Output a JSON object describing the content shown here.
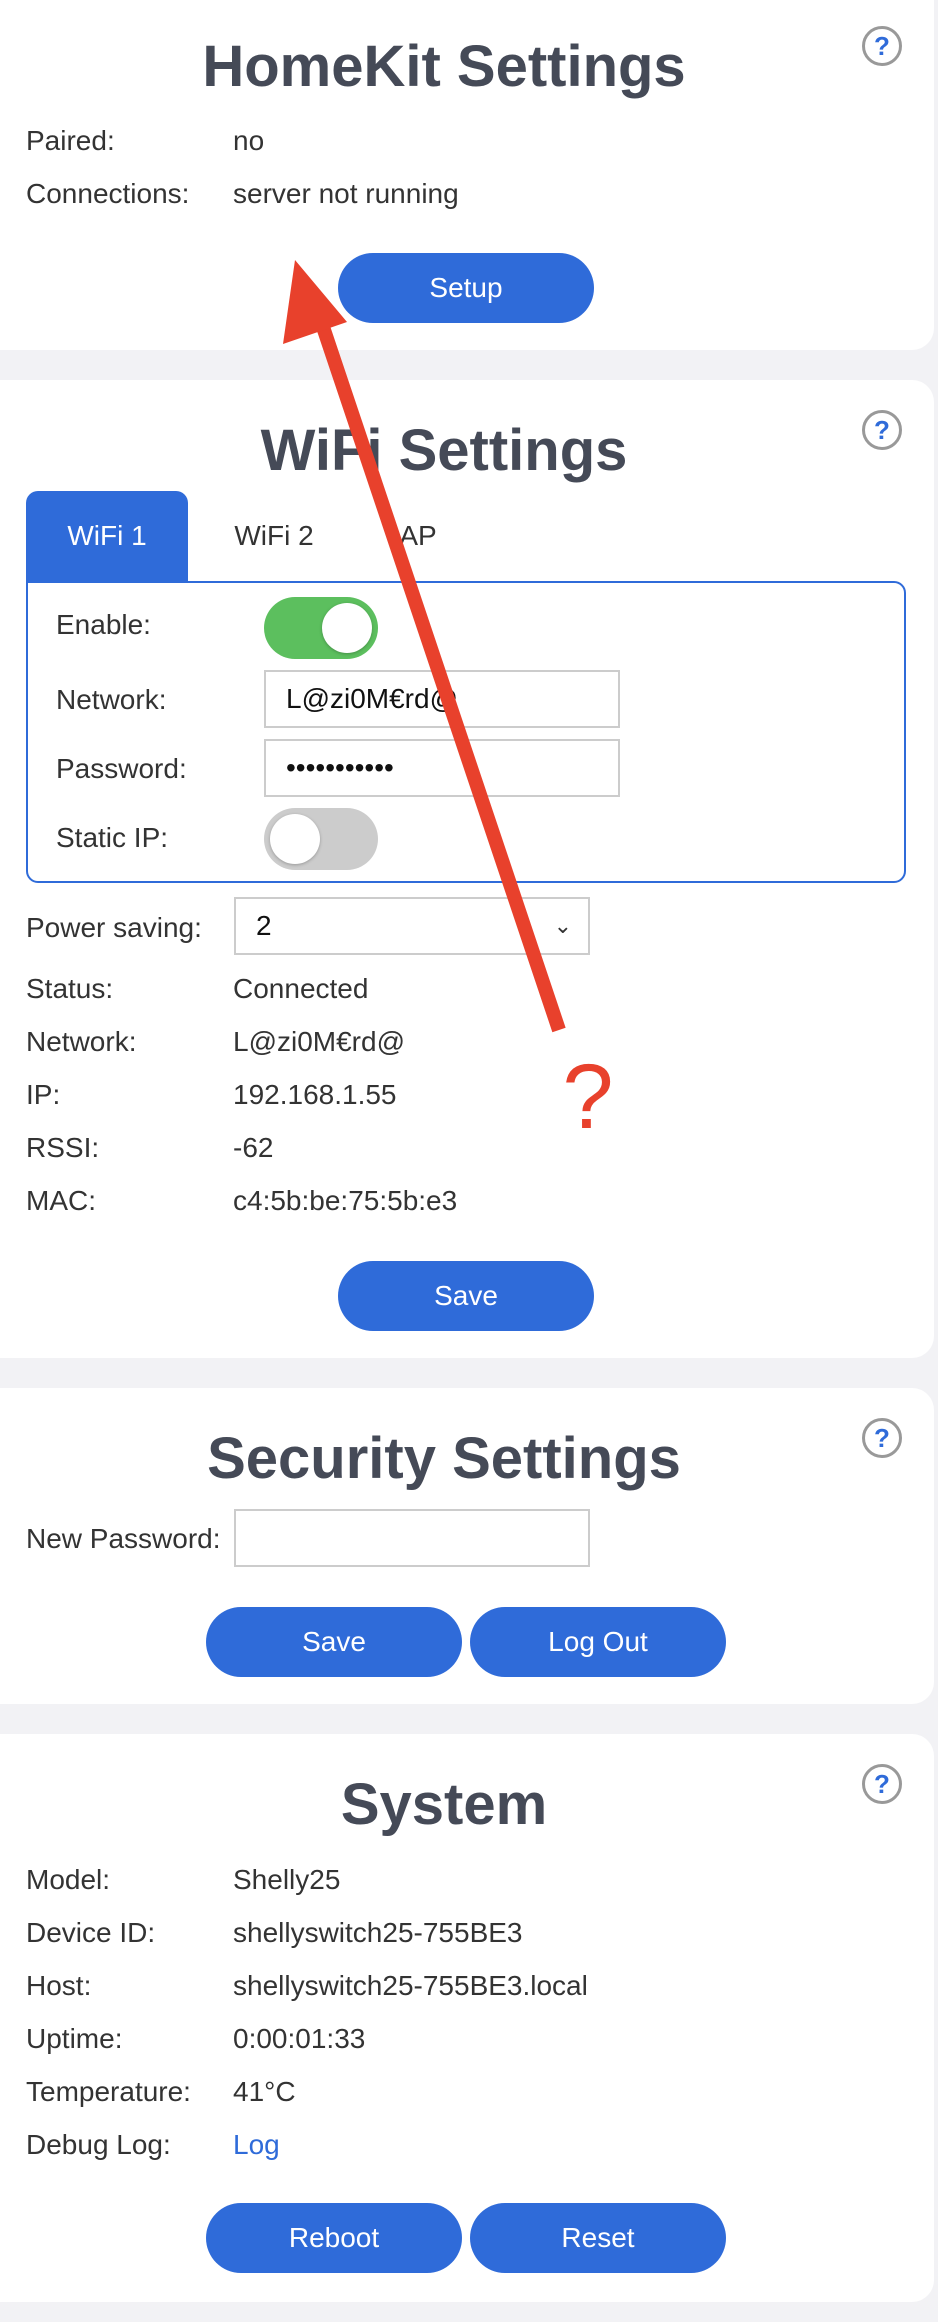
{
  "homekit": {
    "title": "HomeKit Settings",
    "help_label": "?",
    "paired_label": "Paired:",
    "paired_value": "no",
    "connections_label": "Connections:",
    "connections_value": "server not running",
    "setup_button": "Setup"
  },
  "wifi": {
    "title": "WiFi Settings",
    "help_label": "?",
    "tabs": [
      {
        "label": "WiFi 1",
        "active": true
      },
      {
        "label": "WiFi 2",
        "active": false
      },
      {
        "label": "AP",
        "active": false
      }
    ],
    "enable_label": "Enable:",
    "enable_on": true,
    "network_label": "Network:",
    "network_value": "L@zi0M€rd@",
    "password_label": "Password:",
    "password_value": "•••••••••••",
    "static_ip_label": "Static IP:",
    "static_ip_on": false,
    "power_saving_label": "Power saving:",
    "power_saving_value": "2",
    "status": [
      {
        "label": "Status:",
        "value": "Connected"
      },
      {
        "label": "Network:",
        "value": "L@zi0M€rd@"
      },
      {
        "label": "IP:",
        "value": "192.168.1.55"
      },
      {
        "label": "RSSI:",
        "value": "-62"
      },
      {
        "label": "MAC:",
        "value": "c4:5b:be:75:5b:e3"
      }
    ],
    "save_button": "Save"
  },
  "security": {
    "title": "Security Settings",
    "help_label": "?",
    "new_password_label": "New Password:",
    "new_password_value": "",
    "save_button": "Save",
    "logout_button": "Log Out"
  },
  "system": {
    "title": "System",
    "help_label": "?",
    "rows": [
      {
        "label": "Model:",
        "value": "Shelly25"
      },
      {
        "label": "Device ID:",
        "value": "shellyswitch25-755BE3"
      },
      {
        "label": "Host:",
        "value": "shellyswitch25-755BE3.local"
      },
      {
        "label": "Uptime:",
        "value": "0:00:01:33"
      },
      {
        "label": "Temperature:",
        "value": "41°C"
      }
    ],
    "debug_log_label": "Debug Log:",
    "debug_log_link": "Log",
    "reboot_button": "Reboot",
    "reset_button": "Reset"
  },
  "annotation": {
    "mark": "?",
    "color": "#e8412c"
  },
  "colors": {
    "accent": "#2f6bd9",
    "toggle_on": "#5cbf5e",
    "toggle_off": "#cccccc",
    "title": "#454a57",
    "background": "#f2f2f5"
  }
}
